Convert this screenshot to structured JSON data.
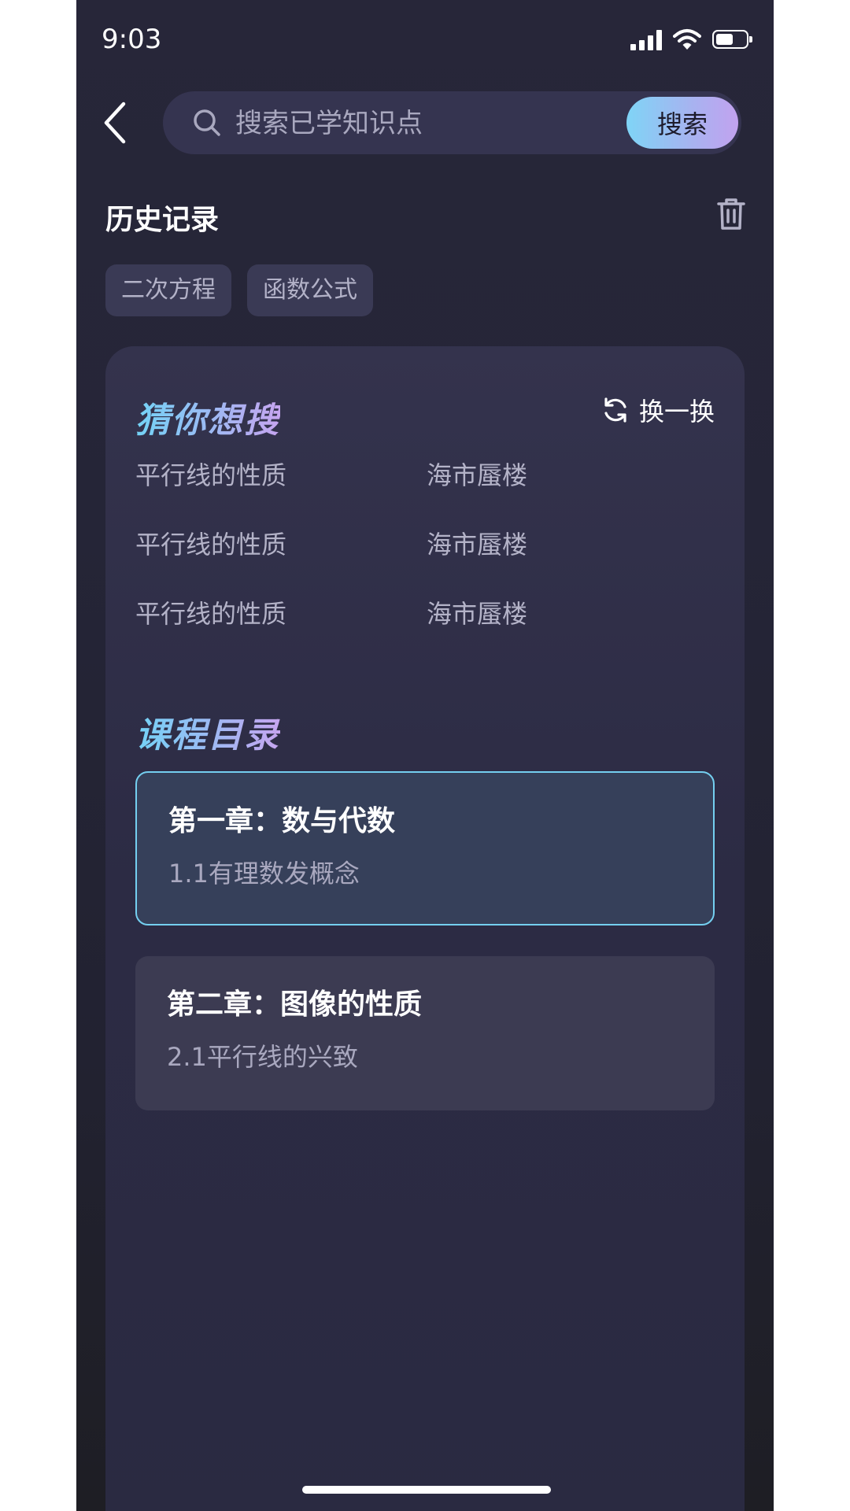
{
  "status_bar": {
    "time": "9:03"
  },
  "search": {
    "placeholder": "搜索已学知识点",
    "button_label": "搜索"
  },
  "history": {
    "title": "历史记录",
    "tags": [
      "二次方程",
      "函数公式"
    ]
  },
  "suggestions": {
    "title": "猜你想搜",
    "refresh_label": "换一换",
    "items": [
      "平行线的性质",
      "海市蜃楼",
      "平行线的性质",
      "海市蜃楼",
      "平行线的性质",
      "海市蜃楼"
    ]
  },
  "catalog": {
    "title": "课程目录",
    "chapters": [
      {
        "name": "第一章：数与代数",
        "sub": "1.1有理数发概念",
        "selected": true
      },
      {
        "name": "第二章：图像的性质",
        "sub": "2.1平行线的兴致",
        "selected": false
      }
    ]
  },
  "colors": {
    "background": "#262538",
    "card": "#302f48",
    "accent_gradient": [
      "#7fd4f6",
      "#c2a2ef"
    ],
    "selected_border": "#74cff0"
  },
  "icons": [
    "back-arrow-icon",
    "search-icon",
    "trash-icon",
    "refresh-icon",
    "signal-icon",
    "wifi-icon",
    "battery-icon"
  ]
}
